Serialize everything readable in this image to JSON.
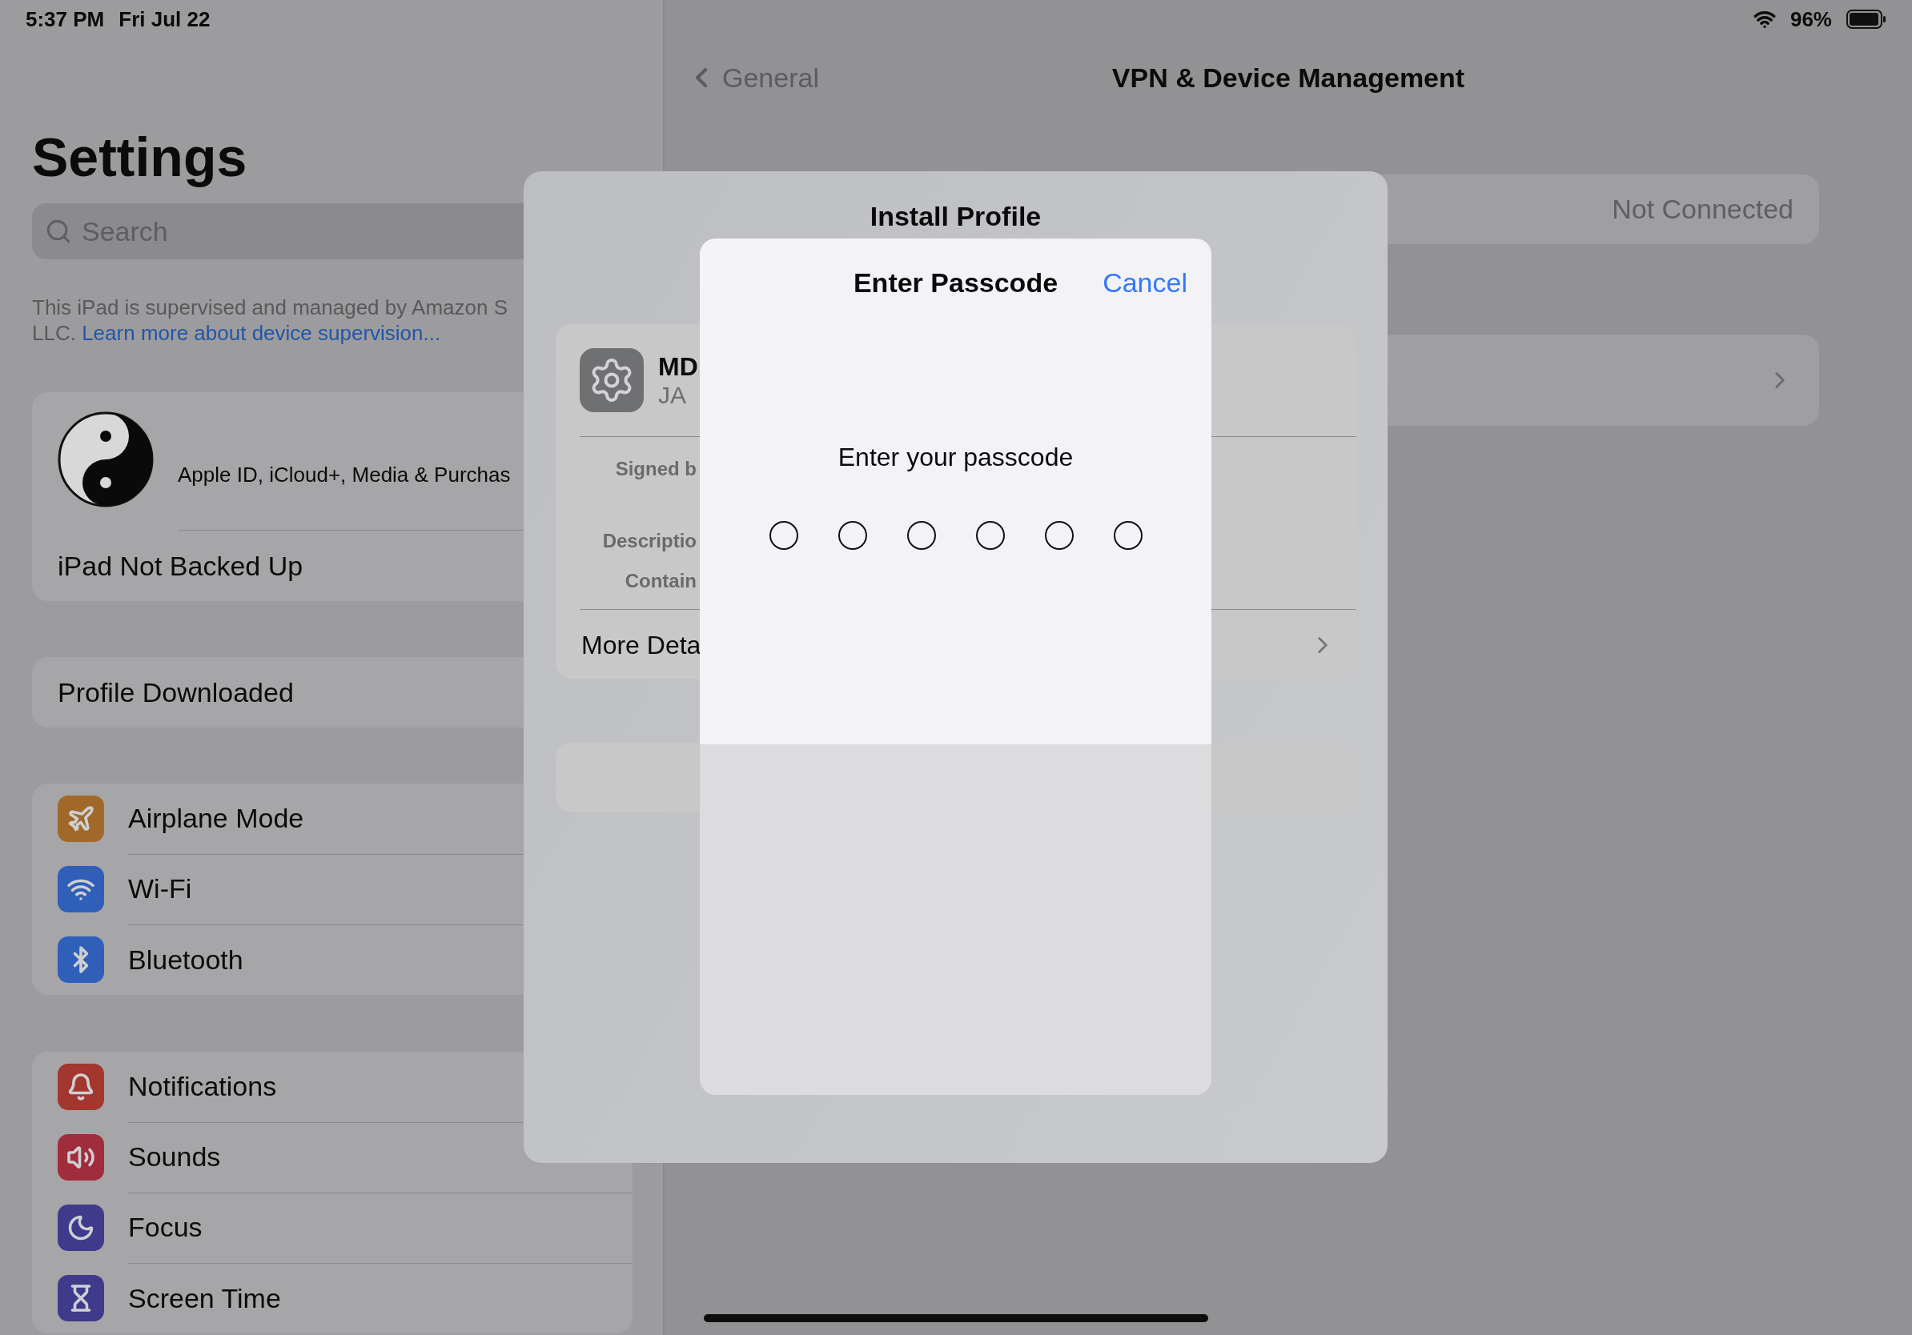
{
  "status_bar": {
    "time": "5:37 PM",
    "date": "Fri Jul 22",
    "battery": "96%"
  },
  "sidebar": {
    "title": "Settings",
    "search": {
      "placeholder": "Search"
    },
    "supervision": {
      "line1": "This iPad is supervised and managed by Amazon S",
      "line2": "LLC.",
      "link": "Learn more about device supervision..."
    },
    "account": {
      "subtitle": "Apple ID, iCloud+, Media & Purchas",
      "backup": "iPad Not Backed Up"
    },
    "profile_downloaded": "Profile Downloaded",
    "groups": [
      [
        {
          "label": "Airplane Mode",
          "kind": "airplane",
          "color": "#a0692a"
        },
        {
          "label": "Wi-Fi",
          "kind": "wifi",
          "color": "#2f5fb8"
        },
        {
          "label": "Bluetooth",
          "kind": "bluetooth",
          "color": "#2f5fb8"
        }
      ],
      [
        {
          "label": "Notifications",
          "kind": "bell",
          "color": "#a3372f"
        },
        {
          "label": "Sounds",
          "kind": "speaker",
          "color": "#a02c3c"
        },
        {
          "label": "Focus",
          "kind": "moon",
          "color": "#3f3a8c"
        },
        {
          "label": "Screen Time",
          "kind": "hourglass",
          "color": "#3f3a8c"
        }
      ]
    ]
  },
  "detail": {
    "back": "General",
    "title": "VPN & Device Management",
    "vpn_status": "Not Connected"
  },
  "install_sheet": {
    "title": "Install Profile",
    "profile_name": "MD",
    "profile_org": "JA",
    "fields": [
      "Signed b",
      "Descriptio",
      "Contain"
    ],
    "more": "More Deta"
  },
  "passcode": {
    "title": "Enter Passcode",
    "cancel": "Cancel",
    "prompt": "Enter your passcode",
    "digits": [
      {
        "filled": false
      },
      {
        "filled": false
      },
      {
        "filled": false
      },
      {
        "filled": false
      },
      {
        "filled": false
      },
      {
        "filled": false
      }
    ]
  }
}
